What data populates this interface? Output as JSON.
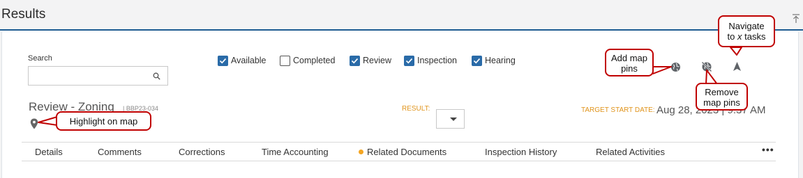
{
  "header": {
    "title": "Results"
  },
  "search": {
    "label": "Search",
    "value": "",
    "placeholder": ""
  },
  "filters": [
    {
      "label": "Available",
      "checked": true
    },
    {
      "label": "Completed",
      "checked": false
    },
    {
      "label": "Review",
      "checked": true
    },
    {
      "label": "Inspection",
      "checked": true
    },
    {
      "label": "Hearing",
      "checked": true
    }
  ],
  "map_tools": {
    "add_pins_icon": "globe-icon",
    "remove_pins_icon": "globe-crossed-icon",
    "navigate_icon": "navigation-arrow-icon"
  },
  "callouts": {
    "add_pins": "Add map pins",
    "remove_pins": "Remove map pins",
    "navigate_line1": "Navigate",
    "navigate_to": "to ",
    "navigate_x": "x",
    "navigate_tasks": " tasks",
    "highlight": "Highlight on map"
  },
  "record": {
    "title": "Review - Zoning",
    "id": "| BBP23-034",
    "result_label": "RESULT:",
    "result_value": "",
    "target_label": "TARGET START DATE:",
    "target_value": "Aug 28, 2023 | 9:37 AM"
  },
  "tabs": [
    {
      "label": "Details"
    },
    {
      "label": "Comments"
    },
    {
      "label": "Corrections"
    },
    {
      "label": "Time Accounting"
    },
    {
      "label": "Related Documents",
      "indicator": true
    },
    {
      "label": "Inspection History"
    },
    {
      "label": "Related Activities"
    }
  ],
  "more_label": "•••",
  "colors": {
    "accent": "#2a6ba8",
    "header_rule": "#1f5d93",
    "callout_border": "#c00000",
    "label_orange": "#e0941c",
    "indicator": "#f5a623"
  }
}
